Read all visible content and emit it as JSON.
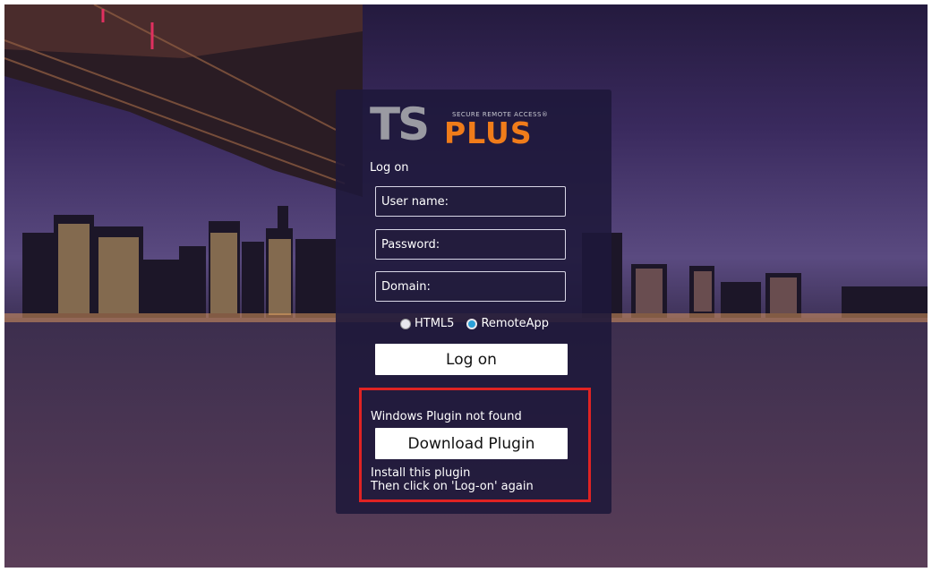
{
  "brand": {
    "logo_ts": "TS",
    "logo_plus": "PLUS",
    "tagline": "SECURE REMOTE ACCESS®"
  },
  "login": {
    "title": "Log on",
    "username_placeholder": "User name:",
    "password_placeholder": "Password:",
    "domain_placeholder": "Domain:",
    "mode_options": [
      "HTML5",
      "RemoteApp"
    ],
    "mode_selected": "RemoteApp",
    "logon_button": "Log on"
  },
  "plugin": {
    "status": "Windows Plugin not found",
    "download_button": "Download Plugin",
    "instruction_1": "Install this plugin",
    "instruction_2": "Then click on 'Log-on' again"
  },
  "colors": {
    "accent_orange": "#f07c1a",
    "highlight_red": "#e02323",
    "panel_bg": "#1e183a"
  }
}
